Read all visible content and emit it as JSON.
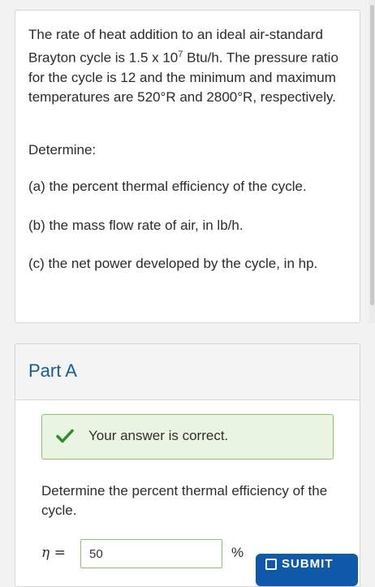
{
  "problem": {
    "intro_a": "The rate of heat addition to an ideal air-standard Brayton cycle is 1.5 x 10",
    "intro_exp": "7",
    "intro_b": " Btu/h. The pressure ratio for the cycle is 12 and the minimum and maximum temperatures are 520°R and 2800°R, respectively.",
    "determine": "Determine:",
    "item_a": "(a) the percent thermal efficiency of the cycle.",
    "item_b": "(b) the mass flow rate of air, in lb/h.",
    "item_c": "(c) the net power developed by the cycle, in hp."
  },
  "part": {
    "title": "Part A",
    "feedback": "Your answer is correct.",
    "question": "Determine the percent thermal efficiency of the cycle.",
    "symbol": "η =",
    "answer_value": "50",
    "unit": "%",
    "submit_label": "SUBMIT",
    "success_color": "#8ec06b",
    "accent_color": "#1b5a91"
  }
}
